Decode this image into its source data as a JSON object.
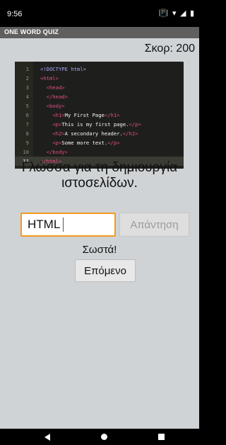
{
  "status_bar": {
    "time": "9:56",
    "icons": [
      "vibrate-icon",
      "wifi-icon",
      "signal-icon",
      "battery-icon"
    ]
  },
  "app_bar": {
    "title": "ONE WORD QUIZ"
  },
  "score": {
    "text": "Σκορ: 200"
  },
  "code_snippet": {
    "lines": [
      {
        "num": "1",
        "text": "<!DOCTYPE html>"
      },
      {
        "num": "2",
        "text": "<html>"
      },
      {
        "num": "3",
        "text": "  <head>"
      },
      {
        "num": "4",
        "text": "  </head>"
      },
      {
        "num": "5",
        "text": "  <body>"
      },
      {
        "num": "6",
        "text": "    <h1>My First Page</h1>"
      },
      {
        "num": "7",
        "text": "    <p>This is my first page.</p>"
      },
      {
        "num": "8",
        "text": "    <h2>A secondary header.</h2>"
      },
      {
        "num": "9",
        "text": "    <p>Some more text.</p>"
      },
      {
        "num": "10",
        "text": "  </body>"
      },
      {
        "num": "11",
        "text": "</html>"
      }
    ],
    "active_line": "11"
  },
  "question": {
    "line1": "Γλώσσα για τη δημιουργία",
    "line2": "ιστοσελίδων."
  },
  "answer": {
    "value": "HTML",
    "button_label": "Απάντηση"
  },
  "feedback": {
    "text": "Σωστά!"
  },
  "next": {
    "label": "Επόμενο"
  },
  "colors": {
    "accent": "#f39a1f",
    "background": "#cfd3d6",
    "app_bar": "#5f5f5f",
    "code_background": "#1e1f1c",
    "code_tag": "#e34c86"
  }
}
